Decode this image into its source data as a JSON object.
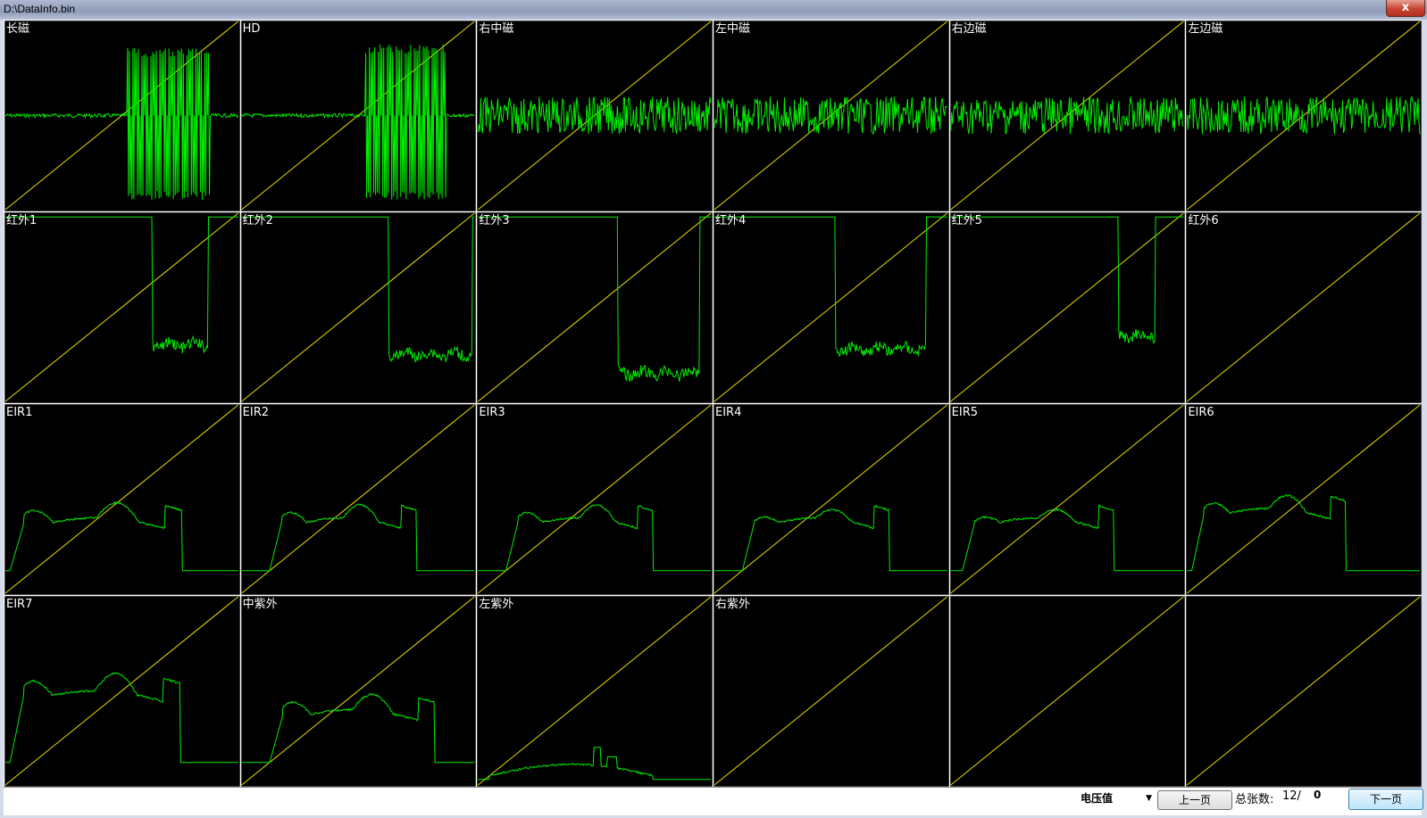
{
  "window": {
    "title": "D:\\DataInfo.bin",
    "close_glyph": "x"
  },
  "chart_data": {
    "type": "line",
    "panels": [
      {
        "title": "长磁",
        "signal": "burst",
        "params": [
          0.52,
          0.88,
          0.14
        ]
      },
      {
        "title": "HD",
        "signal": "burst",
        "params": [
          0.53,
          0.88,
          0.12
        ]
      },
      {
        "title": "右中磁",
        "signal": "noise",
        "params": [
          0.2
        ]
      },
      {
        "title": "左中磁",
        "signal": "noise",
        "params": [
          0.2
        ]
      },
      {
        "title": "右边磁",
        "signal": "noise",
        "params": [
          0.2
        ]
      },
      {
        "title": "左边磁",
        "signal": "noise",
        "params": [
          0.2
        ]
      },
      {
        "title": "红外1",
        "signal": "drop",
        "params": [
          0.63,
          0.87,
          0.28,
          0.7
        ]
      },
      {
        "title": "红外2",
        "signal": "drop",
        "params": [
          0.63,
          0.99,
          0.28,
          0.75
        ]
      },
      {
        "title": "红外3",
        "signal": "drop",
        "params": [
          0.6,
          0.95,
          0.28,
          0.85
        ]
      },
      {
        "title": "红外4",
        "signal": "drop",
        "params": [
          0.52,
          0.91,
          0.26,
          0.72
        ]
      },
      {
        "title": "红外5",
        "signal": "drop",
        "params": [
          0.72,
          0.88,
          0.26,
          0.65
        ]
      },
      {
        "title": "红外6",
        "signal": "none",
        "params": []
      },
      {
        "title": "EIR1",
        "signal": "hump",
        "params": [
          0.02,
          0.76,
          0.2,
          0.35
        ]
      },
      {
        "title": "EIR2",
        "signal": "hump",
        "params": [
          0.12,
          0.75,
          0.2,
          0.3
        ]
      },
      {
        "title": "EIR3",
        "signal": "hump",
        "params": [
          0.12,
          0.75,
          0.2,
          0.3
        ]
      },
      {
        "title": "EIR4",
        "signal": "hump",
        "params": [
          0.12,
          0.75,
          0.2,
          0.2
        ]
      },
      {
        "title": "EIR5",
        "signal": "hump",
        "params": [
          0.05,
          0.7,
          0.2,
          0.2
        ]
      },
      {
        "title": "EIR6",
        "signal": "hump",
        "params": [
          0.02,
          0.68,
          0.25,
          0.3
        ]
      },
      {
        "title": "EIR7",
        "signal": "hump",
        "params": [
          0.02,
          0.75,
          0.3,
          0.4
        ]
      },
      {
        "title": "中紫外",
        "signal": "hump",
        "params": [
          0.12,
          0.83,
          0.2,
          0.35
        ]
      },
      {
        "title": "左紫外",
        "signal": "spike",
        "params": [
          0.05,
          0.75,
          0.05,
          0.25
        ]
      },
      {
        "title": "右紫外",
        "signal": "none",
        "params": []
      },
      {
        "title": "",
        "signal": "none",
        "params": []
      },
      {
        "title": "",
        "signal": "none",
        "params": []
      }
    ]
  },
  "colors": {
    "signal": "#00ee00",
    "diagonal": "#e8e000",
    "grid": "#ffffff",
    "label": "#ffffff",
    "background": "#000000"
  },
  "controls": {
    "mode_value": "电压值",
    "prev_label": "上一页",
    "total_label": "总张数:",
    "page_current": "12/",
    "page_total": "0",
    "next_label": "下一页",
    "dropdown_icon": "chevron-down-icon"
  }
}
